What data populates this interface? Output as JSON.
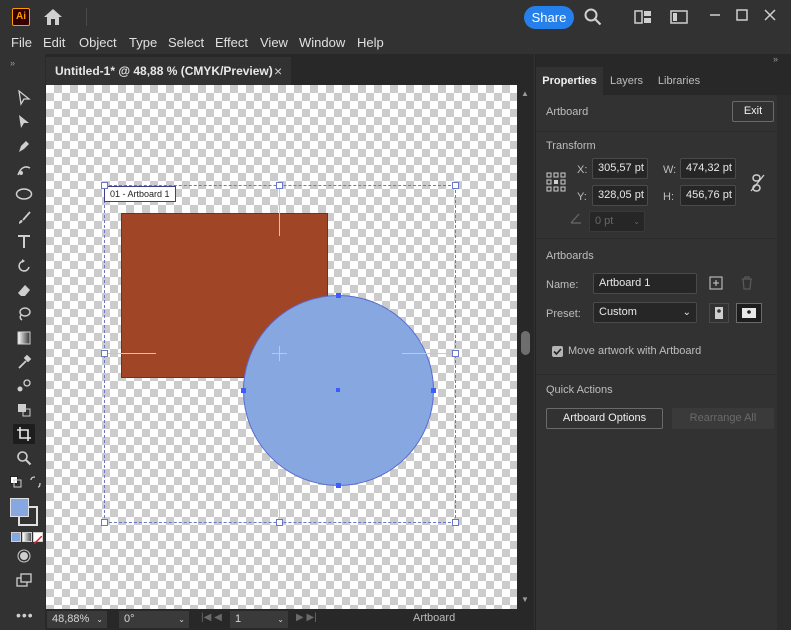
{
  "app": {
    "logo": "Ai",
    "share_label": "Share"
  },
  "menu": [
    "File",
    "Edit",
    "Object",
    "Type",
    "Select",
    "Effect",
    "View",
    "Window",
    "Help"
  ],
  "document": {
    "tab_title": "Untitled-1* @ 48,88 % (CMYK/Preview)",
    "close": "×"
  },
  "canvas": {
    "artboard_label": "01 - Artboard 1",
    "rect_color": "#a04526",
    "circle_color": "#87a7e0"
  },
  "status": {
    "zoom": "48,88%",
    "rotation": "0°",
    "artboard_number": "1",
    "mode_label": "Artboard"
  },
  "panel": {
    "tabs": [
      "Properties",
      "Layers",
      "Libraries"
    ],
    "artboard_section": "Artboard",
    "exit_label": "Exit",
    "transform_title": "Transform",
    "x_label": "X:",
    "x_value": "305,57 pt",
    "y_label": "Y:",
    "y_value": "328,05 pt",
    "w_label": "W:",
    "w_value": "474,32 pt",
    "h_label": "H:",
    "h_value": "456,76 pt",
    "angle_value": "0 pt",
    "artboards_title": "Artboards",
    "name_label": "Name:",
    "name_value": "Artboard 1",
    "preset_label": "Preset:",
    "preset_value": "Custom",
    "move_artwork_label": "Move artwork with Artboard",
    "quick_actions_title": "Quick Actions",
    "artboard_options_label": "Artboard Options",
    "rearrange_label": "Rearrange All"
  },
  "colors": {
    "accent": "#2680eb",
    "fill": "#87a7e0"
  }
}
